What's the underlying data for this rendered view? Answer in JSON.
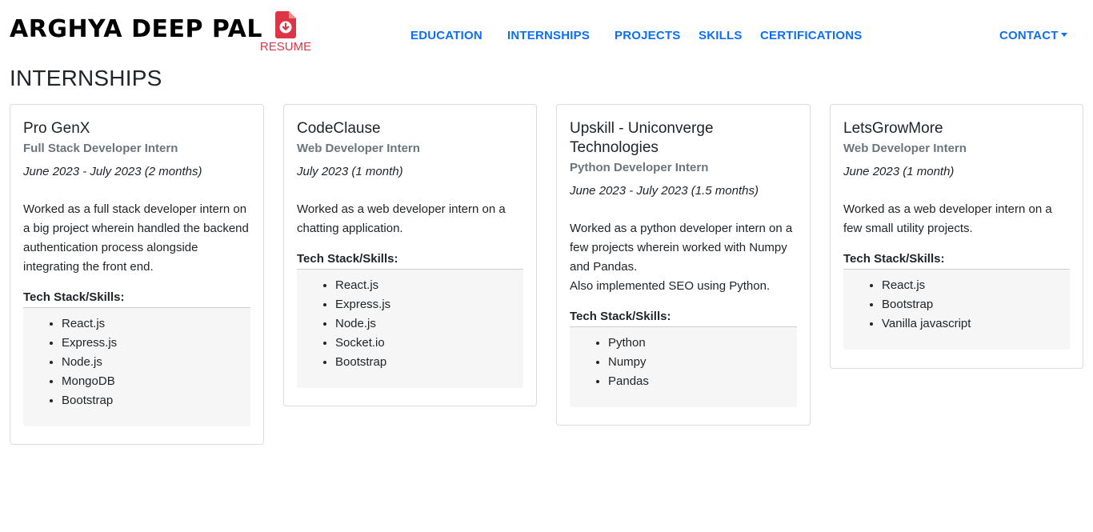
{
  "brand": "ARGHYA DEEP PAL",
  "resume": {
    "label": "RESUME",
    "icon": "pdf-download-icon"
  },
  "nav": {
    "items": [
      "EDUCATION",
      "INTERNSHIPS",
      "PROJECTS",
      "SKILLS",
      "CERTIFICATIONS"
    ],
    "contact": "CONTACT"
  },
  "colors": {
    "link": "#0d6efd",
    "resume": "#dc3545",
    "muted": "#6c757d"
  },
  "section_title": "INTERNSHIPS",
  "internships": [
    {
      "company": "Pro GenX",
      "role": "Full Stack Developer Intern",
      "period": "June 2023 - July 2023 (2 months)",
      "description": [
        "Worked as a full stack developer intern on a big project wherein handled the backend authentication process alongside integrating the front end."
      ],
      "skills_title": "Tech Stack/Skills:",
      "skills": [
        "React.js",
        "Express.js",
        "Node.js",
        "MongoDB",
        "Bootstrap"
      ]
    },
    {
      "company": "CodeClause",
      "role": "Web Developer Intern",
      "period": "July 2023 (1 month)",
      "description": [
        "Worked as a web developer intern on a chatting application."
      ],
      "skills_title": "Tech Stack/Skills:",
      "skills": [
        "React.js",
        "Express.js",
        "Node.js",
        "Socket.io",
        "Bootstrap"
      ]
    },
    {
      "company": "Upskill - Uniconverge Technologies",
      "role": "Python Developer Intern",
      "period": "June 2023 - July 2023 (1.5 months)",
      "description": [
        "Worked as a python developer intern on a few projects wherein worked with Numpy and Pandas.",
        "Also implemented SEO using Python."
      ],
      "skills_title": "Tech Stack/Skills:",
      "skills": [
        "Python",
        "Numpy",
        "Pandas"
      ]
    },
    {
      "company": "LetsGrowMore",
      "role": "Web Developer Intern",
      "period": "June 2023 (1 month)",
      "description": [
        "Worked as a web developer intern on a few small utility projects."
      ],
      "skills_title": "Tech Stack/Skills:",
      "skills": [
        "React.js",
        "Bootstrap",
        "Vanilla javascript"
      ]
    }
  ]
}
